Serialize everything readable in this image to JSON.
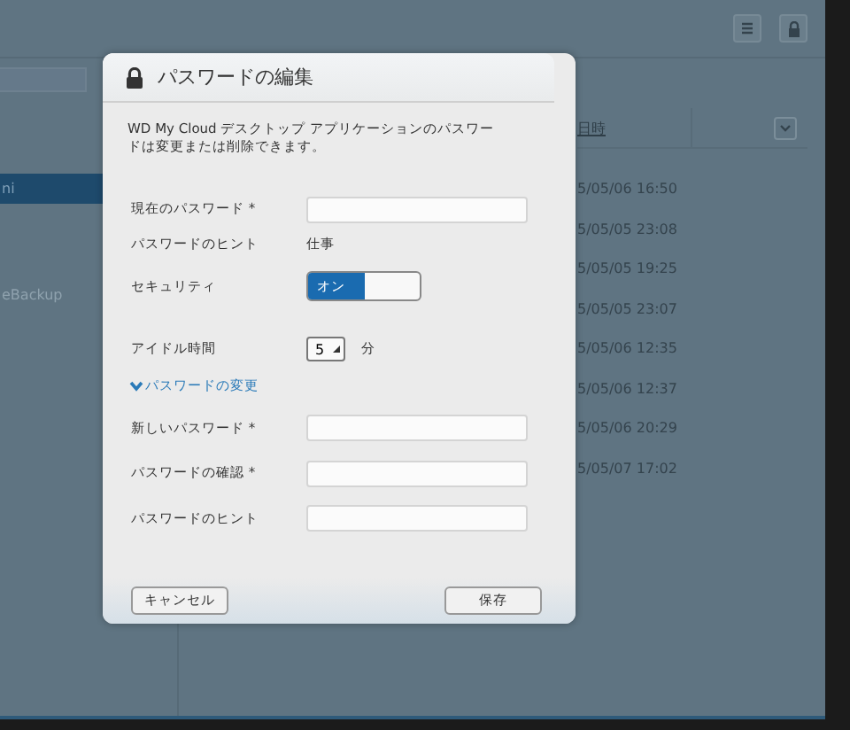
{
  "background": {
    "sidebar": {
      "items": [
        {
          "label": "ni",
          "selected": true
        },
        {
          "label": "eBackup",
          "selected": false
        }
      ]
    },
    "table": {
      "column_header": "日時",
      "rows": [
        "5/05/06 16:50",
        "5/05/05 23:08",
        "5/05/05 19:25",
        "5/05/05 23:07",
        "5/05/06 12:35",
        "5/05/06 12:37",
        "5/05/06 20:29",
        "5/05/07 17:02"
      ]
    }
  },
  "dialog": {
    "title": "パスワードの編集",
    "description": "WD My Cloud デスクトップ アプリケーションのパスワードは変更または削除できます。",
    "fields": [
      {
        "kind": "input",
        "label": "現在のパスワード *"
      },
      {
        "kind": "text",
        "label": "パスワードのヒント",
        "value": "仕事"
      },
      {
        "kind": "toggle",
        "label": "セキュリティ",
        "value": "オン",
        "on": true
      },
      {
        "kind": "spinner",
        "label": "アイドル時間",
        "value": "5",
        "unit": "分"
      }
    ],
    "section": {
      "label": "パスワードの変更",
      "expanded": true
    },
    "change_fields": [
      {
        "label": "新しいパスワード *"
      },
      {
        "label": "パスワードの確認 *"
      },
      {
        "label": "パスワードのヒント"
      }
    ],
    "buttons": {
      "cancel": "キャンセル",
      "save": "保存"
    }
  }
}
